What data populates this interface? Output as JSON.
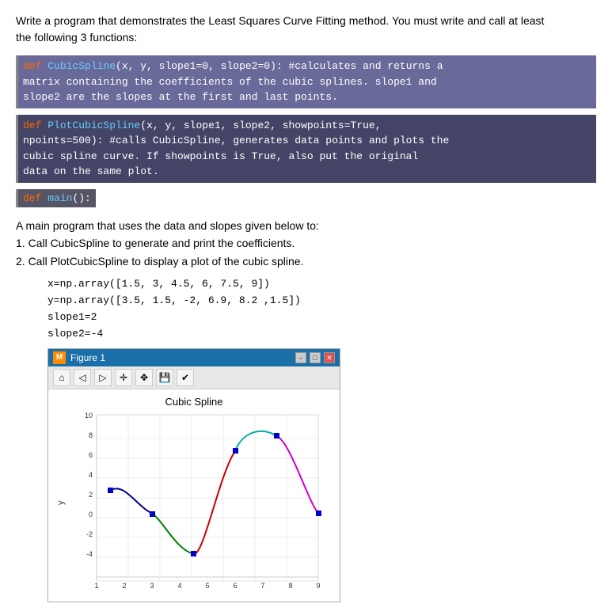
{
  "intro": {
    "line1": "Write a program that demonstrates the Least Squares Curve Fitting method.  You must write and call at least",
    "line2": "the following 3 functions:"
  },
  "code_block_1": {
    "line1": "def CubicSpline(x, y, slope1=0, slope2=0): #calculates and returns a",
    "line2": "matrix containing the coefficients of the cubic splines. slope1 and",
    "line3": "slope2 are the slopes at the first and last points."
  },
  "code_block_2": {
    "line1": "def PlotCubicSpline(x, y, slope1, slope2, showpoints=True,",
    "line2": "npoints=500): #calls CubicSpline, generates data points and plots the",
    "line3": "cubic spline curve.  If showpoints is True, also put the original",
    "line4": "data on the same plot."
  },
  "code_block_3": {
    "line1": "def main():"
  },
  "description": {
    "line1": "A main program that uses the data and slopes given below to:",
    "line2": "1. Call CubicSpline to generate and print the coefficients.",
    "line3": "2. Call PlotCubicSpline to display a plot of the cubic spline."
  },
  "code_values": {
    "line1": "x=np.array([1.5, 3, 4.5, 6, 7.5, 9])",
    "line2": "y=np.array([3.5, 1.5, -2, 6.9, 8.2 ,1.5])",
    "line3": "slope1=2",
    "line4": "slope2=-4"
  },
  "figure": {
    "title": "Figure 1",
    "plot_title": "Cubic Spline",
    "y_axis_label": "y",
    "toolbar_buttons": [
      "🏠",
      "⬅",
      "➡",
      "✛",
      "✥",
      "💾",
      "✔"
    ],
    "win_controls": [
      "-",
      "□",
      "✕"
    ]
  }
}
